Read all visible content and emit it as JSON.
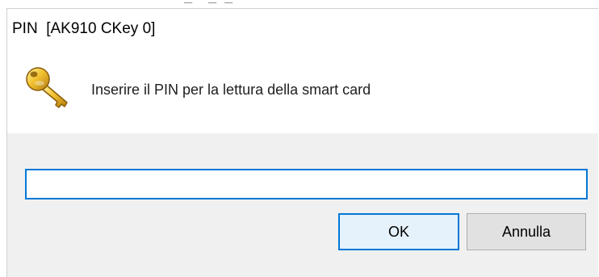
{
  "dialog": {
    "title": "PIN  [AK910 CKey 0]",
    "message": "Inserire il PIN per la lettura della smart card",
    "icon": "key-icon",
    "pin_value": "",
    "buttons": {
      "ok": "OK",
      "cancel": "Annulla"
    }
  },
  "colors": {
    "accent": "#0078d7",
    "footer_bg": "#f0f0f0",
    "ok_bg": "#e5f1fb",
    "cancel_bg": "#e1e1e1"
  }
}
